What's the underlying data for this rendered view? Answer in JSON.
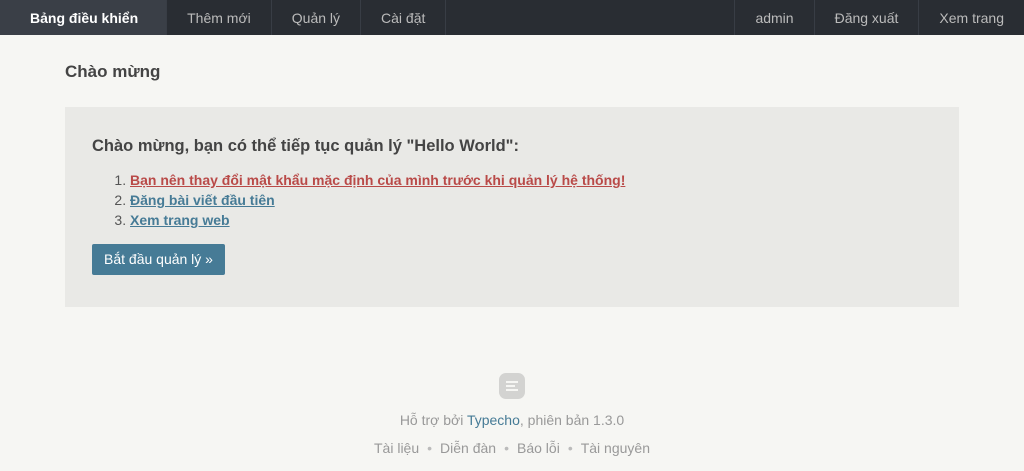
{
  "topbar": {
    "left": [
      {
        "label": "Bảng điều khiển",
        "active": true
      },
      {
        "label": "Thêm mới"
      },
      {
        "label": "Quản lý"
      },
      {
        "label": "Cài đặt"
      }
    ],
    "right": [
      {
        "label": "admin"
      },
      {
        "label": "Đăng xuất"
      },
      {
        "label": "Xem trang"
      }
    ]
  },
  "main": {
    "title": "Chào mừng",
    "welcome": {
      "heading": "Chào mừng, bạn có thể tiếp tục quản lý \"Hello World\":",
      "steps": [
        {
          "label": "Bạn nên thay đổi mật khẩu mặc định của mình trước khi quản lý hệ thống!"
        },
        {
          "label": "Đăng bài viết đầu tiên"
        },
        {
          "label": "Xem trang web"
        }
      ],
      "start_button": "Bắt đầu quản lý »"
    }
  },
  "footer": {
    "powered_prefix": "Hỗ trợ bởi ",
    "powered_link": "Typecho",
    "powered_suffix": ", phiên bản 1.3.0",
    "links": [
      "Tài liệu",
      "Diễn đàn",
      "Báo lỗi",
      "Tài nguyên"
    ]
  },
  "colors": {
    "topbar_bg": "#292d33",
    "accent": "#467b96",
    "warning": "#b94a48",
    "page_bg": "#f6f6f3",
    "box_bg": "#e9e9e6"
  }
}
